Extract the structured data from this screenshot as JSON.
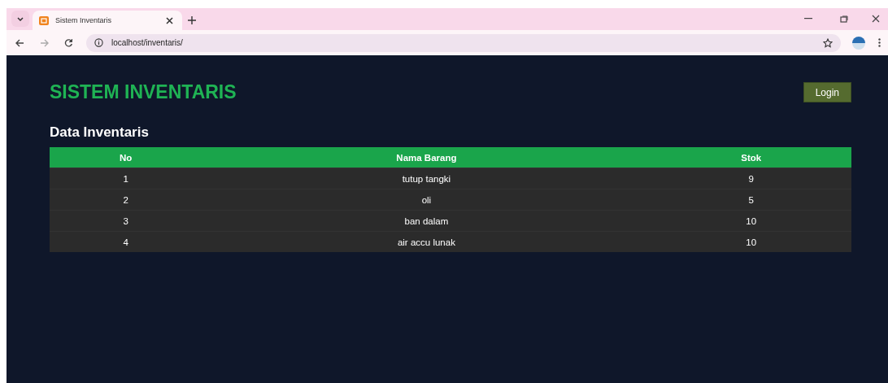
{
  "browser": {
    "tab": {
      "title": "Sistem Inventaris",
      "selected": true
    },
    "address": "localhost/inventaris/"
  },
  "page": {
    "title": "SISTEM INVENTARIS",
    "login_button": "Login",
    "section_title": "Data Inventaris",
    "table": {
      "columns": [
        "No",
        "Nama Barang",
        "Stok"
      ],
      "rows": [
        {
          "no": "1",
          "name": "tutup tangki",
          "stock": "9"
        },
        {
          "no": "2",
          "name": "oli",
          "stock": "5"
        },
        {
          "no": "3",
          "name": "ban dalam",
          "stock": "10"
        },
        {
          "no": "4",
          "name": "air accu lunak",
          "stock": "10"
        }
      ]
    }
  }
}
